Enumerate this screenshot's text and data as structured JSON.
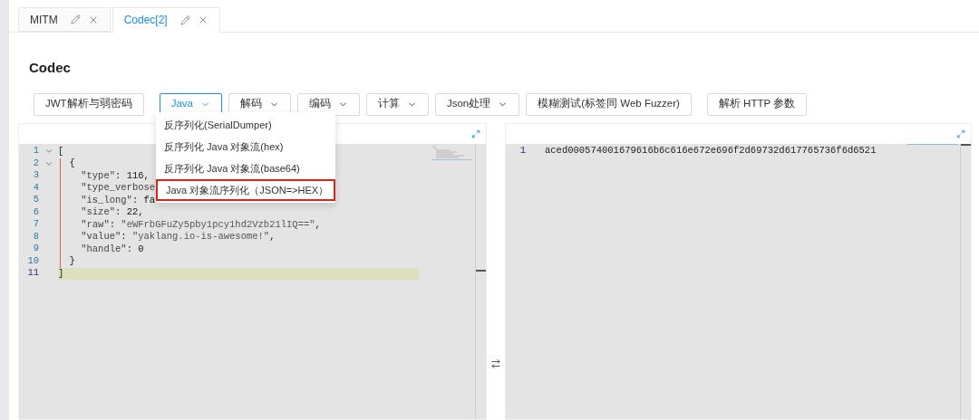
{
  "tabs": [
    {
      "label": "MITM",
      "selected": false
    },
    {
      "label": "Codec[2]",
      "selected": true
    }
  ],
  "title": "Codec",
  "toolbar": [
    {
      "label": "JWT解析与弱密码",
      "kind": "plain",
      "selected": false
    },
    {
      "label": "Java",
      "kind": "dropdown",
      "selected": true
    },
    {
      "label": "解码",
      "kind": "dropdown",
      "selected": false
    },
    {
      "label": "编码",
      "kind": "dropdown",
      "selected": false
    },
    {
      "label": "计算",
      "kind": "dropdown",
      "selected": false
    },
    {
      "label": "Json处理",
      "kind": "dropdown",
      "selected": false
    },
    {
      "label": "模糊测试(标签同 Web Fuzzer)",
      "kind": "plain",
      "selected": false
    },
    {
      "label": "解析 HTTP 参数",
      "kind": "plain",
      "selected": false
    }
  ],
  "menu": [
    {
      "label": "反序列化(SerialDumper)",
      "highlighted": false
    },
    {
      "label": "反序列化 Java 对象流(hex)",
      "highlighted": false
    },
    {
      "label": "反序列化 Java 对象流(base64)",
      "highlighted": false
    },
    {
      "label": "Java 对象流序列化（JSON=>HEX）",
      "highlighted": true
    }
  ],
  "input_editor": {
    "lines": [
      {
        "number": "1",
        "foldable": true,
        "active": false,
        "segments": [
          {
            "text": "[",
            "kind": "punct"
          }
        ]
      },
      {
        "number": "2",
        "foldable": true,
        "active": false,
        "segments": [
          {
            "text": "  {",
            "kind": "punct"
          }
        ]
      },
      {
        "number": "3",
        "foldable": false,
        "active": false,
        "segments": [
          {
            "text": "    \"type\"",
            "kind": "key"
          },
          {
            "text": ": ",
            "kind": "punct"
          },
          {
            "text": "116",
            "kind": "number"
          },
          {
            "text": ",",
            "kind": "punct"
          }
        ]
      },
      {
        "number": "4",
        "foldable": false,
        "active": false,
        "segments": [
          {
            "text": "    \"type_verbose",
            "kind": "key"
          }
        ]
      },
      {
        "number": "5",
        "foldable": false,
        "active": false,
        "segments": [
          {
            "text": "    \"is_long\"",
            "kind": "key"
          },
          {
            "text": ": ",
            "kind": "punct"
          },
          {
            "text": "fa",
            "kind": "number"
          }
        ]
      },
      {
        "number": "6",
        "foldable": false,
        "active": false,
        "segments": [
          {
            "text": "    \"size\"",
            "kind": "key"
          },
          {
            "text": ": ",
            "kind": "punct"
          },
          {
            "text": "22",
            "kind": "number"
          },
          {
            "text": ",",
            "kind": "punct"
          }
        ]
      },
      {
        "number": "7",
        "foldable": false,
        "active": false,
        "segments": [
          {
            "text": "    \"raw\"",
            "kind": "key"
          },
          {
            "text": ": ",
            "kind": "punct"
          },
          {
            "text": "\"eWFrbGFuZy5pby1pcy1hd2Vzb21lIQ==\"",
            "kind": "string"
          },
          {
            "text": ",",
            "kind": "punct"
          }
        ]
      },
      {
        "number": "8",
        "foldable": false,
        "active": false,
        "segments": [
          {
            "text": "    \"value\"",
            "kind": "key"
          },
          {
            "text": ": ",
            "kind": "punct"
          },
          {
            "text": "\"yaklang.io-is-awesome!\"",
            "kind": "string"
          },
          {
            "text": ",",
            "kind": "punct"
          }
        ]
      },
      {
        "number": "9",
        "foldable": false,
        "active": false,
        "segments": [
          {
            "text": "    \"handle\"",
            "kind": "key"
          },
          {
            "text": ": ",
            "kind": "punct"
          },
          {
            "text": "0",
            "kind": "number"
          }
        ]
      },
      {
        "number": "10",
        "foldable": false,
        "active": false,
        "segments": [
          {
            "text": "  }",
            "kind": "punct"
          }
        ]
      },
      {
        "number": "11",
        "foldable": false,
        "active": true,
        "segments": [
          {
            "text": "]",
            "kind": "punct"
          }
        ]
      }
    ]
  },
  "output_editor": {
    "lines": [
      {
        "number": "1",
        "text": "aced000574001679616b6c616e672e696f2d69732d617765736f6d6521"
      }
    ]
  }
}
